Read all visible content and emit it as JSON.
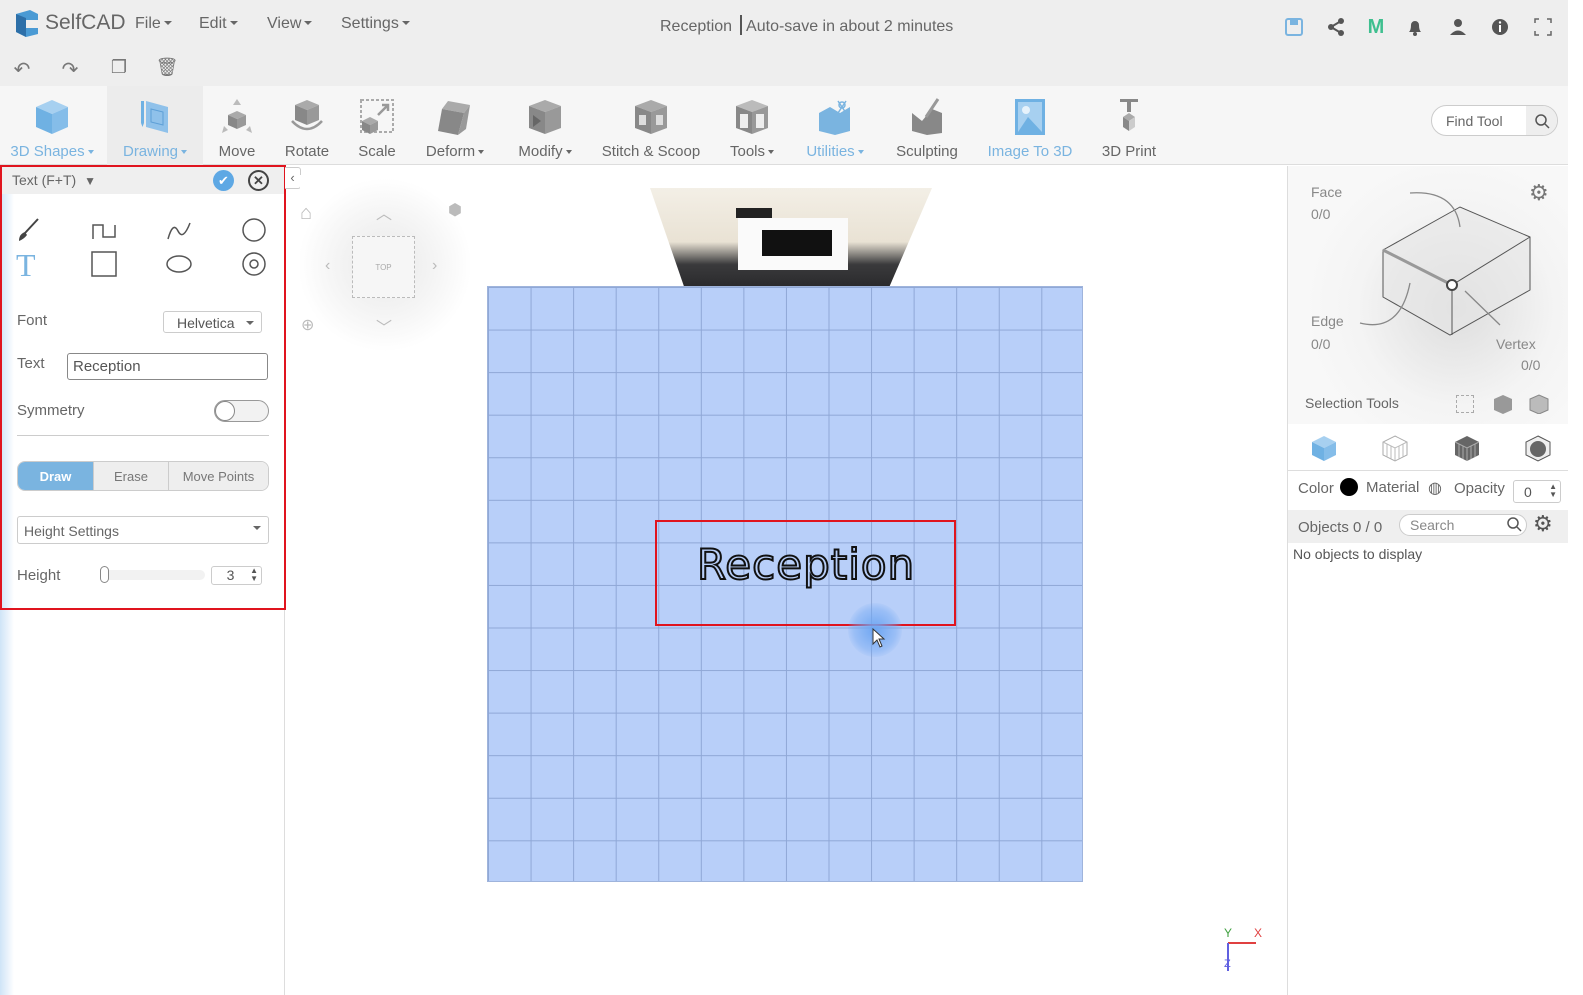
{
  "app": {
    "name": "SelfCAD",
    "document_title": "Reception",
    "autosave": "Auto-save in about 2 minutes",
    "accent": "#7ab4e0"
  },
  "menu": [
    "File",
    "Edit",
    "View",
    "Settings"
  ],
  "top_icons": [
    "save-icon",
    "share-icon",
    "m-icon",
    "bell-icon",
    "user-icon",
    "info-icon",
    "fullscreen-icon"
  ],
  "quick_actions": [
    "undo-icon",
    "redo-icon",
    "copy-icon",
    "delete-icon"
  ],
  "toolbar": {
    "tools": [
      {
        "label": "3D Shapes",
        "dropdown": true
      },
      {
        "label": "Drawing",
        "dropdown": true,
        "active": true
      },
      {
        "label": "Move"
      },
      {
        "label": "Rotate"
      },
      {
        "label": "Scale"
      },
      {
        "label": "Deform",
        "dropdown": true
      },
      {
        "label": "Modify",
        "dropdown": true
      },
      {
        "label": "Stitch & Scoop"
      },
      {
        "label": "Tools",
        "dropdown": true
      },
      {
        "label": "Utilities",
        "dropdown": true
      },
      {
        "label": "Sculpting"
      },
      {
        "label": "Image To 3D"
      },
      {
        "label": "3D Print"
      }
    ],
    "find_placeholder": "Find Tool"
  },
  "left_panel": {
    "title": "Text (F+T)",
    "draw_tools": [
      "brush-icon",
      "polyline-icon",
      "curve-icon",
      "circle-icon",
      "text-icon",
      "rectangle-icon",
      "ellipse-icon",
      "ring-icon"
    ],
    "font_label": "Font",
    "font_value": "Helvetica",
    "text_label": "Text",
    "text_value": "Reception",
    "symmetry_label": "Symmetry",
    "symmetry_on": false,
    "modes": [
      "Draw",
      "Erase",
      "Move Points"
    ],
    "active_mode": "Draw",
    "height_settings": "Height Settings",
    "height_label": "Height",
    "height_value": "3"
  },
  "viewport": {
    "view_label": "TOP",
    "text_preview": "Reception",
    "axes": {
      "y": "Y",
      "x": "X",
      "z": "Z"
    }
  },
  "right_panel": {
    "face_label": "Face",
    "face_count": "0/0",
    "edge_label": "Edge",
    "edge_count": "0/0",
    "vertex_label": "Vertex",
    "vertex_count": "0/0",
    "selection_tools": "Selection Tools",
    "color_label": "Color",
    "color_value": "#000000",
    "material_label": "Material",
    "opacity_label": "Opacity",
    "opacity_value": "0",
    "objects_label": "Objects 0 / 0",
    "search_placeholder": "Search",
    "empty": "No objects to display"
  }
}
